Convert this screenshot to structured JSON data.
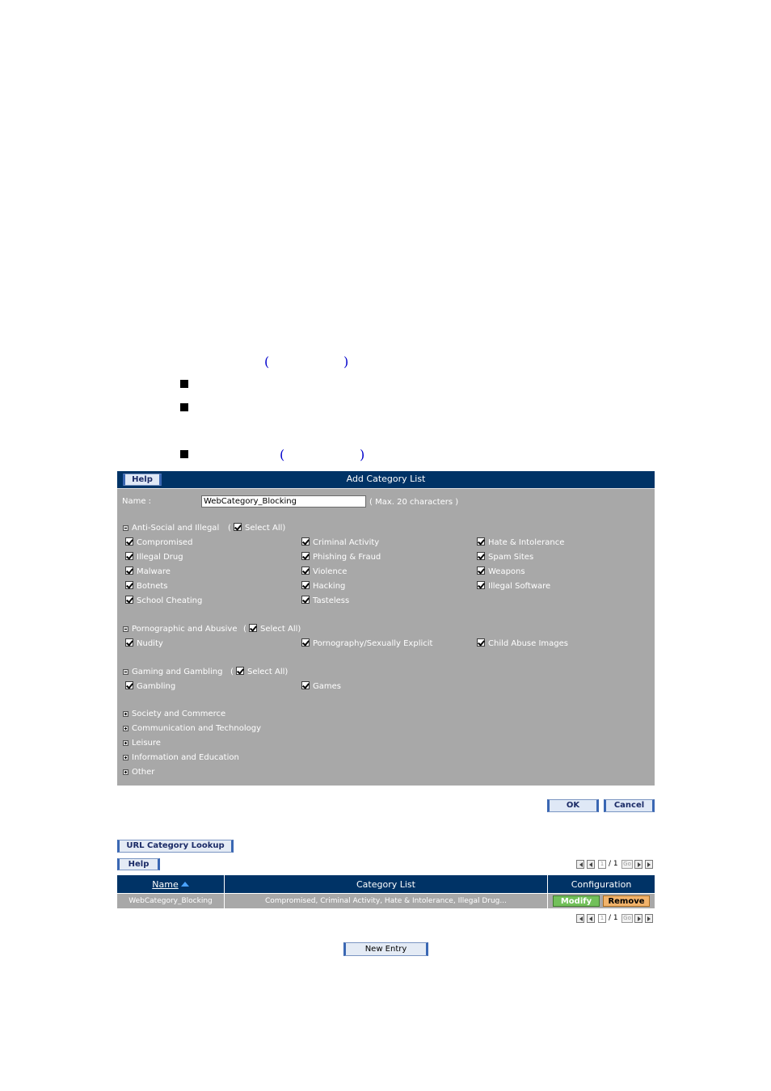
{
  "doc": {
    "paren_open": "(",
    "paren_close": ")"
  },
  "panel": {
    "help_label": "Help",
    "title": "Add Category List",
    "name_label": "Name :",
    "name_value": "WebCategory_Blocking",
    "name_hint": "( Max. 20 characters )",
    "select_all_label": "Select All)",
    "groups": [
      {
        "label": "Anti-Social and Illegal",
        "items": [
          "Compromised",
          "Criminal Activity",
          "Hate & Intolerance",
          "Illegal Drug",
          "Phishing & Fraud",
          "Spam Sites",
          "Malware",
          "Violence",
          "Weapons",
          "Botnets",
          "Hacking",
          "Illegal Software",
          "School Cheating",
          "Tasteless"
        ]
      },
      {
        "label": "Pornographic and Abusive",
        "items": [
          "Nudity",
          "Pornography/Sexually Explicit",
          "Child Abuse Images"
        ]
      },
      {
        "label": "Gaming and Gambling",
        "items": [
          "Gambling",
          "Games"
        ]
      }
    ],
    "collapsed_groups": [
      "Society and Commerce",
      "Communication and Technology",
      "Leisure",
      "Information and Education",
      "Other"
    ],
    "ok_label": "OK",
    "cancel_label": "Cancel"
  },
  "list": {
    "lookup_label": "URL Category Lookup",
    "help_label": "Help",
    "page_current": "1",
    "page_sep": "/ 1",
    "go_label": "Go",
    "headers": {
      "name": "Name",
      "category_list": "Category List",
      "configuration": "Configuration"
    },
    "rows": [
      {
        "name": "WebCategory_Blocking",
        "categories": "Compromised, Criminal Activity, Hate & Intolerance, Illegal Drug...",
        "modify": "Modify",
        "remove": "Remove"
      }
    ],
    "new_entry_label": "New Entry"
  }
}
